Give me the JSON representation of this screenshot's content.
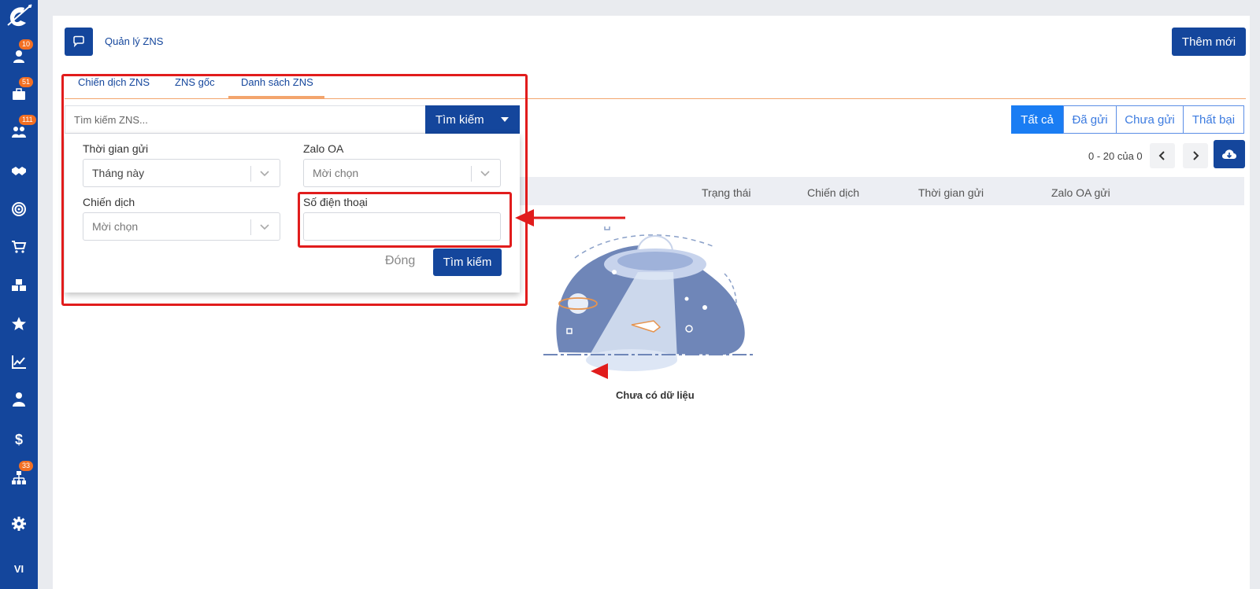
{
  "sidebar": {
    "badges": {
      "users": "10",
      "briefcase": "51",
      "groups": "111",
      "hierarchy": "33"
    },
    "language": "VI"
  },
  "header": {
    "title": "Quản lý ZNS",
    "add_button": "Thêm mới"
  },
  "tabs": [
    "Chiến dịch ZNS",
    "ZNS gốc",
    "Danh sách ZNS"
  ],
  "search": {
    "placeholder": "Tìm kiếm ZNS...",
    "button": "Tìm kiếm"
  },
  "status_filter": [
    "Tất cả",
    "Đã gửi",
    "Chưa gửi",
    "Thất bại"
  ],
  "pagination": {
    "text": "0 - 20 của 0"
  },
  "table": {
    "columns": [
      "Trạng thái",
      "Chiến dịch",
      "Thời gian gửi",
      "Zalo OA gửi"
    ]
  },
  "filter_panel": {
    "send_time_label": "Thời gian gửi",
    "send_time_value": "Tháng này",
    "zalo_oa_label": "Zalo OA",
    "zalo_oa_value": "Mời chọn",
    "campaign_label": "Chiến dịch",
    "campaign_value": "Mời chọn",
    "phone_label": "Số điện thoại",
    "phone_value": "",
    "close_button": "Đóng",
    "search_button": "Tìm kiếm"
  },
  "empty_state": {
    "text": "Chưa có dữ liệu"
  },
  "colors": {
    "primary": "#14469c",
    "active_filter": "#1a7df3",
    "accent": "#f3a56d",
    "badge": "#f36f22",
    "annotation": "#e11c1c"
  }
}
